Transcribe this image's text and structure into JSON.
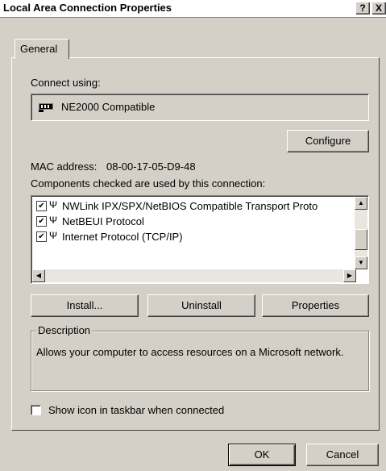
{
  "window": {
    "title": "Local Area Connection Properties",
    "help_glyph": "?",
    "close_glyph": "X"
  },
  "tabs": [
    {
      "label": "General"
    }
  ],
  "connect_using": {
    "label": "Connect using:",
    "adapter_name": "NE2000 Compatible"
  },
  "buttons": {
    "configure": "Configure",
    "install": "Install...",
    "uninstall": "Uninstall",
    "properties": "Properties",
    "ok": "OK",
    "cancel": "Cancel"
  },
  "mac": {
    "label": "MAC address:",
    "value": "08-00-17-05-D9-48"
  },
  "components": {
    "label": "Components checked are used by this connection:",
    "items": [
      {
        "label": "NWLink IPX/SPX/NetBIOS Compatible Transport Proto",
        "checked": true
      },
      {
        "label": "NetBEUI Protocol",
        "checked": true
      },
      {
        "label": "Internet Protocol (TCP/IP)",
        "checked": true
      }
    ]
  },
  "description": {
    "title": "Description",
    "text": "Allows your computer to access resources on a Microsoft network."
  },
  "show_icon": {
    "label": "Show icon in taskbar when connected",
    "checked": false
  },
  "icons": {
    "adapter": "network-card-icon",
    "protocol": "network-protocol-icon"
  }
}
